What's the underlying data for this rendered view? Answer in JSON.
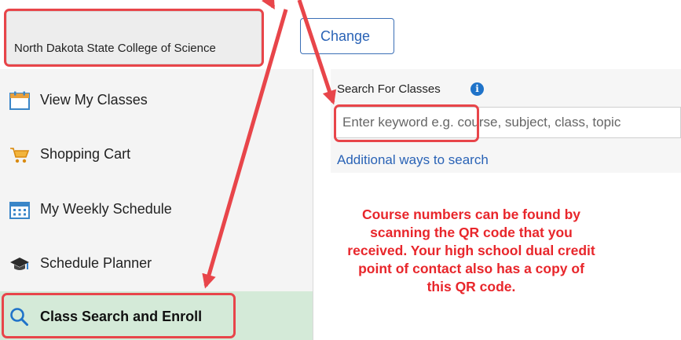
{
  "institution": {
    "name": "North Dakota State College of Science",
    "change_label": "Change"
  },
  "sidebar": {
    "items": [
      {
        "label": "View My Classes",
        "icon": "calendar-icon"
      },
      {
        "label": "Shopping Cart",
        "icon": "shopping-cart-icon"
      },
      {
        "label": "My Weekly Schedule",
        "icon": "weekly-calendar-icon"
      },
      {
        "label": "Schedule Planner",
        "icon": "graduation-cap-icon"
      },
      {
        "label": "Class Search and Enroll",
        "icon": "search-icon",
        "active": true
      }
    ]
  },
  "search": {
    "title": "Search For Classes",
    "info_glyph": "i",
    "placeholder": "Enter keyword e.g. course, subject, class, topic",
    "additional_link": "Additional ways to search"
  },
  "annotation": {
    "note": "Course numbers can be found by scanning the QR code that you received. Your high school dual credit point of contact also has a copy of this QR code.",
    "highlight_color": "#e8454a",
    "note_color": "#e8262b"
  },
  "colors": {
    "link": "#2a63b6",
    "active_bg": "#d4ead8",
    "info": "#1f73c9"
  }
}
